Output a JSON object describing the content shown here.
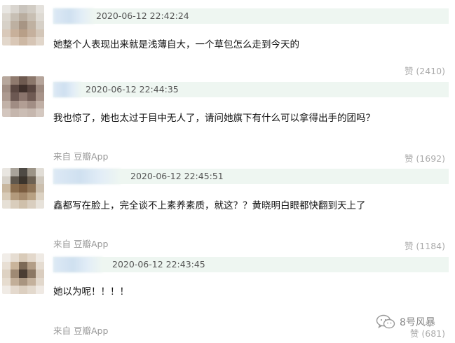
{
  "comments": [
    {
      "timestamp": "2020-06-12 22:42:24",
      "text": "她整个人表现出来就是浅薄自大，一个草包怎么走到今天的",
      "source": "",
      "likes": "赞 (2410)",
      "avatar_colors": [
        "#e8e6e2",
        "#d9d5cf",
        "#c9c4bd",
        "#d1ccc4",
        "#e4e1dc",
        "#dcd7cf",
        "#c7bfb4",
        "#b9ad9f",
        "#c8bfb3",
        "#dedad3",
        "#d7d1c8",
        "#bdb0a1",
        "#a79584",
        "#bfb1a1",
        "#d6d0c7",
        "#d9c9ba",
        "#c8b09a",
        "#b89f88",
        "#c5b09d",
        "#d3c6b8",
        "#e2d7cb",
        "#d9c7b6",
        "#cdb8a4",
        "#d6c5b5",
        "#e1d6ca"
      ]
    },
    {
      "timestamp": "2020-06-12 22:44:35",
      "text": "我也惊了，她也太过于目中无人了，请问她旗下有什么可以拿得出手的团吗？",
      "source": "来自 豆瓣App",
      "likes": "赞 (1692)",
      "avatar_colors": [
        "#b7a79c",
        "#8f7a6e",
        "#6e5a50",
        "#8b776b",
        "#b5a49a",
        "#a18e84",
        "#5b4842",
        "#3f302b",
        "#594640",
        "#9d8a80",
        "#ad9a90",
        "#6c5852",
        "#8a746c",
        "#6f5a53",
        "#a79389",
        "#c2b2a8",
        "#a08c83",
        "#b29e94",
        "#a28e85",
        "#c0afa5",
        "#d3c6be",
        "#c5b6ad",
        "#cbbdb4",
        "#c6b7ae",
        "#d4c8c0"
      ]
    },
    {
      "timestamp": "2020-06-12 22:45:51",
      "text": "鑫都写在脸上，完全谈不上素养素质，就这？？黄晓明白眼都快翻到天上了",
      "source": "来自 豆瓣App",
      "likes": "赞 (1184)",
      "avatar_colors": [
        "#e9e6e1",
        "#a9a39a",
        "#4e4a44",
        "#9c9487",
        "#e1ddd6",
        "#d7d2ca",
        "#5f574d",
        "#3b342c",
        "#6c6153",
        "#cfc8bd",
        "#c9b79f",
        "#8a6d4e",
        "#7a5c3f",
        "#8f7558",
        "#cbbfae",
        "#d8cbb8",
        "#b39a7c",
        "#a58a6c",
        "#b8a183",
        "#dcd2c3",
        "#e6e0d6",
        "#d9cdbc",
        "#cfc0ab",
        "#d9cebf",
        "#e7e2da"
      ]
    },
    {
      "timestamp": "2020-06-12 22:43:45",
      "text": "她以为呢！！！！",
      "source": "来自 豆瓣App",
      "likes": "赞 (681)",
      "avatar_colors": [
        "#f1ede8",
        "#e6ddd2",
        "#d9cbb9",
        "#e3d8cb",
        "#efeae4",
        "#e8dfd4",
        "#c9b49b",
        "#7d6a57",
        "#b39e87",
        "#e5dcd1",
        "#ded2c3",
        "#9f8a74",
        "#4a3d33",
        "#8c7864",
        "#dacdbf",
        "#e6dccf",
        "#c2ae98",
        "#a99580",
        "#c4b19c",
        "#e2d8cc",
        "#f0ebe5",
        "#e4d9cd",
        "#dccfc0",
        "#e3d9cd",
        "#efe9e3"
      ]
    }
  ],
  "watermark": {
    "label": "8号风暴",
    "icon": "wechat-icon"
  }
}
